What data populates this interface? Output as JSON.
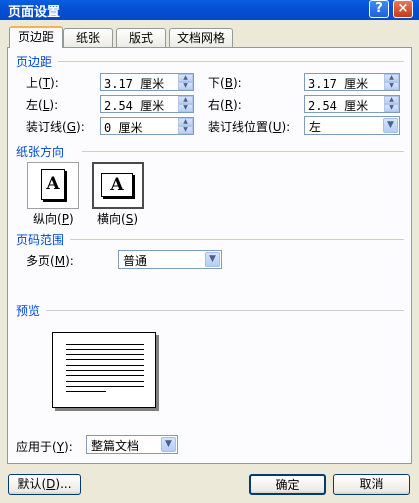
{
  "window": {
    "title": "页面设置",
    "help_label": "?",
    "close_label": "×"
  },
  "tabs": [
    {
      "label": "页边距"
    },
    {
      "label": "纸张"
    },
    {
      "label": "版式"
    },
    {
      "label": "文档网格"
    }
  ],
  "margins": {
    "heading": "页边距",
    "top": {
      "label": "上",
      "key": "T",
      "value": "3.17 厘米"
    },
    "bottom": {
      "label": "下",
      "key": "B",
      "value": "3.17 厘米"
    },
    "left": {
      "label": "左",
      "key": "L",
      "value": "2.54 厘米"
    },
    "right": {
      "label": "右",
      "key": "R",
      "value": "2.54 厘米"
    },
    "gutter": {
      "label": "装订线",
      "key": "G",
      "value": "0 厘米"
    },
    "gutter_pos": {
      "label": "装订线位置",
      "key": "U",
      "value": "左"
    }
  },
  "orientation": {
    "heading": "纸张方向",
    "page_glyph": "A",
    "portrait": {
      "label": "纵向",
      "key": "P"
    },
    "landscape": {
      "label": "横向",
      "key": "S"
    },
    "selected": "landscape"
  },
  "pages": {
    "heading": "页码范围",
    "multiple": {
      "label": "多页",
      "key": "M",
      "value": "普通"
    }
  },
  "preview": {
    "heading": "预览",
    "apply_to": {
      "label": "应用于",
      "key": "Y",
      "value": "整篇文档"
    }
  },
  "buttons": {
    "default": {
      "label": "默认",
      "key": "D",
      "suffix": "..."
    },
    "ok": "确定",
    "cancel": "取消"
  },
  "colors": {
    "titlebar": "#0450d6",
    "section_heading": "#0046d5",
    "dialog_bg": "#ece9d8",
    "tab_highlight": "#f5b443"
  }
}
